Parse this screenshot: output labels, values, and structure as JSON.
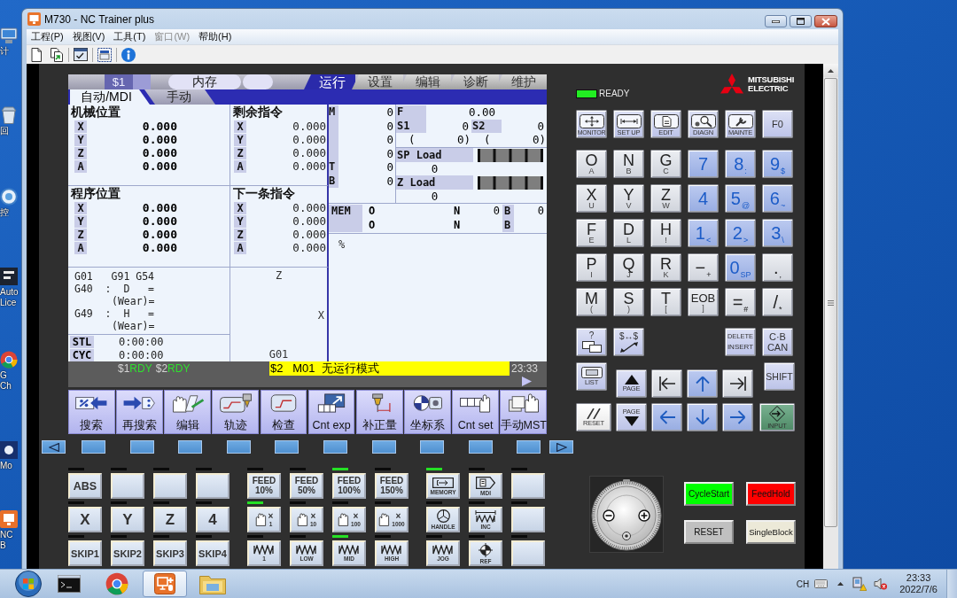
{
  "desktop": {
    "shortcuts": [
      {
        "label": "计"
      },
      {
        "label": "回"
      },
      {
        "label": "控"
      },
      {
        "label": "Auto Lice"
      },
      {
        "label": "G Ch"
      },
      {
        "label": "Mo"
      },
      {
        "label": "NC B"
      }
    ]
  },
  "window": {
    "title": "M730 - NC Trainer plus"
  },
  "menu": [
    {
      "label": "工程(P)",
      "disabled": false
    },
    {
      "label": "视图(V)",
      "disabled": false
    },
    {
      "label": "工具(T)",
      "disabled": false
    },
    {
      "label": "窗口(W)",
      "disabled": true
    },
    {
      "label": "帮助(H)",
      "disabled": false
    }
  ],
  "cnc_screen": {
    "system": "$1",
    "memory_mode": "内存",
    "tabs": [
      {
        "label": "运行",
        "selected": true
      },
      {
        "label": "设置",
        "selected": false
      },
      {
        "label": "编辑",
        "selected": false
      },
      {
        "label": "诊断",
        "selected": false
      },
      {
        "label": "维护",
        "selected": false
      }
    ],
    "subtabs": [
      {
        "label": "自动/MDI",
        "selected": true
      },
      {
        "label": "手动",
        "selected": false
      }
    ],
    "counters": [
      {
        "title": "机械位置",
        "kind": "main",
        "axes": [
          {
            "axis": "X",
            "value": "0.000"
          },
          {
            "axis": "Y",
            "value": "0.000"
          },
          {
            "axis": "Z",
            "value": "0.000"
          },
          {
            "axis": "A",
            "value": "0.000"
          }
        ]
      },
      {
        "title": "剩余指令",
        "kind": "sub",
        "axes": [
          {
            "axis": "X",
            "value": "0.000"
          },
          {
            "axis": "Y",
            "value": "0.000"
          },
          {
            "axis": "Z",
            "value": "0.000"
          },
          {
            "axis": "A",
            "value": "0.000"
          }
        ]
      },
      {
        "title": "程序位置",
        "kind": "main",
        "axes": [
          {
            "axis": "X",
            "value": "0.000"
          },
          {
            "axis": "Y",
            "value": "0.000"
          },
          {
            "axis": "Z",
            "value": "0.000"
          },
          {
            "axis": "A",
            "value": "0.000"
          }
        ]
      },
      {
        "title": "下一条指令",
        "kind": "sub",
        "axes": [
          {
            "axis": "X",
            "value": "0.000"
          },
          {
            "axis": "Y",
            "value": "0.000"
          },
          {
            "axis": "Z",
            "value": "0.000"
          },
          {
            "axis": "A",
            "value": "0.000"
          }
        ]
      }
    ],
    "modal": [
      {
        "kind": "line",
        "text": "G01   G91 G54"
      },
      {
        "kind": "line",
        "text": "G40  :  D   ="
      },
      {
        "kind": "wear",
        "text": "(Wear)="
      },
      {
        "kind": "line",
        "text": "G49  :  H   ="
      },
      {
        "kind": "wear",
        "text": "(Wear)="
      }
    ],
    "times": [
      {
        "label": "STL",
        "value": "0:00:00"
      },
      {
        "label": "CYC",
        "value": "0:00:00"
      }
    ],
    "plot": {
      "vertical_axis": "Z",
      "horizontal_axis": "X",
      "mode": "G01"
    },
    "codes": [
      {
        "label": "M",
        "value": "0"
      },
      {
        "value": "0"
      },
      {
        "value": "0"
      },
      {
        "value": "0"
      },
      {
        "label": "T",
        "value": "0"
      },
      {
        "label": "B",
        "value": "0"
      }
    ],
    "feed": {
      "label": "F",
      "value": "0.00"
    },
    "spindles": [
      {
        "label": "S1",
        "value": "0",
        "bracket": "(",
        "sub_value": "0)"
      },
      {
        "label": "S2",
        "value": "0",
        "bracket": "(",
        "sub_value": "0)"
      }
    ],
    "loads": [
      {
        "label": "SP Load",
        "value": "0"
      },
      {
        "label": "Z Load",
        "value": "0"
      }
    ],
    "program_rows": [
      {
        "mode": "MEM",
        "fields": [
          {
            "label": "O"
          },
          {
            "label": "N",
            "value": "0"
          },
          {
            "label": "B",
            "value": "0"
          }
        ]
      },
      {
        "fields": [
          {
            "label": "O"
          },
          {
            "label": "N"
          },
          {
            "label": "B"
          }
        ]
      }
    ],
    "program_text": "%",
    "channels": [
      {
        "system": "$1",
        "state": "RDY"
      },
      {
        "system": "$2",
        "state": "RDY"
      }
    ],
    "message": "$2   M01  无运行模式",
    "time": "23:33",
    "menu_keys": [
      {
        "label": "搜索"
      },
      {
        "label": "再搜索"
      },
      {
        "label": "编辑"
      },
      {
        "label": "轨迹"
      },
      {
        "label": "检查"
      },
      {
        "label": "Cnt exp"
      },
      {
        "label": "补正量"
      },
      {
        "label": "坐标系"
      },
      {
        "label": "Cnt set"
      },
      {
        "label": "手动MST"
      }
    ]
  },
  "softkeys": [
    {
      "kind": "prev"
    },
    {
      "kind": "blank"
    },
    {
      "kind": "blank"
    },
    {
      "kind": "blank"
    },
    {
      "kind": "blank"
    },
    {
      "kind": "blank"
    },
    {
      "kind": "blank"
    },
    {
      "kind": "blank"
    },
    {
      "kind": "blank"
    },
    {
      "kind": "blank"
    },
    {
      "kind": "blank"
    },
    {
      "kind": "next"
    }
  ],
  "keypad": {
    "ready": {
      "label": "READY",
      "on": true
    },
    "brand": [
      "MITSUBISHI",
      "ELECTRIC"
    ],
    "rows": [
      [
        {
          "kind": "func",
          "caption": "MONITOR"
        },
        {
          "kind": "func",
          "caption": "SET UP"
        },
        {
          "kind": "func",
          "caption": "EDIT"
        },
        {
          "kind": "func",
          "caption": "DIAGN"
        },
        {
          "kind": "func",
          "caption": "MAINTE"
        },
        {
          "kind": "text",
          "main": "F0"
        }
      ],
      [
        {
          "kind": "alpha",
          "main": "O",
          "sub": "A"
        },
        {
          "kind": "alpha",
          "main": "N",
          "sub": "B"
        },
        {
          "kind": "alpha",
          "main": "G",
          "sub": "C"
        },
        {
          "kind": "digit",
          "main": "7"
        },
        {
          "kind": "digit",
          "main": "8",
          "sub": ":"
        },
        {
          "kind": "digit",
          "main": "9",
          "sub": "$"
        }
      ],
      [
        {
          "kind": "alpha",
          "main": "X",
          "sub": "U"
        },
        {
          "kind": "alpha",
          "main": "Y",
          "sub": "V"
        },
        {
          "kind": "alpha",
          "main": "Z",
          "sub": "W"
        },
        {
          "kind": "digit",
          "main": "4"
        },
        {
          "kind": "digit",
          "main": "5",
          "sub": "@"
        },
        {
          "kind": "digit",
          "main": "6",
          "sub": "~"
        }
      ],
      [
        {
          "kind": "alpha",
          "main": "F",
          "sub": "E"
        },
        {
          "kind": "alpha",
          "main": "D",
          "sub": "L"
        },
        {
          "kind": "alpha",
          "main": "H",
          "sub": "!"
        },
        {
          "kind": "digit",
          "main": "1",
          "sub": "<"
        },
        {
          "kind": "digit",
          "main": "2",
          "sub": ">"
        },
        {
          "kind": "digit",
          "main": "3",
          "sub": "\\"
        }
      ],
      [
        {
          "kind": "alpha",
          "main": "P",
          "sub": "I"
        },
        {
          "kind": "alpha",
          "main": "Q",
          "sub": "J"
        },
        {
          "kind": "alpha",
          "main": "R",
          "sub": "K"
        },
        {
          "kind": "symbol",
          "main": "−",
          "sub": "+"
        },
        {
          "kind": "digit",
          "main": "0",
          "sub": "SP"
        },
        {
          "kind": "symbol",
          "main": ".",
          "sub": ","
        }
      ],
      [
        {
          "kind": "alpha",
          "main": "M",
          "sub": "("
        },
        {
          "kind": "alpha",
          "main": "S",
          "sub": ")"
        },
        {
          "kind": "alpha",
          "main": "T",
          "sub": "["
        },
        {
          "kind": "eob",
          "main": "EOB",
          "sub": "]"
        },
        {
          "kind": "symbol",
          "main": "=",
          "sub": "#"
        },
        {
          "kind": "symbol",
          "main": "/",
          "sub": "*"
        }
      ],
      [
        {
          "kind": "help",
          "main": "?"
        },
        {
          "kind": "system",
          "main": "$↔$"
        },
        "",
        "",
        {
          "kind": "text",
          "main": "DELETE",
          "sub": "INSERT"
        },
        {
          "kind": "text",
          "main": "C·B",
          "sub": "CAN"
        }
      ],
      [
        {
          "kind": "list",
          "caption": "LIST"
        },
        {
          "kind": "page_up",
          "caption": "PAGE"
        },
        {
          "kind": "home"
        },
        {
          "kind": "up"
        },
        {
          "kind": "end"
        },
        {
          "kind": "text",
          "main": "SHIFT"
        }
      ],
      [
        {
          "kind": "reset",
          "caption": "RESET"
        },
        {
          "kind": "page_down",
          "caption": "PAGE"
        },
        {
          "kind": "left"
        },
        {
          "kind": "down"
        },
        {
          "kind": "right"
        },
        {
          "kind": "input",
          "caption": "INPUT"
        }
      ]
    ]
  },
  "operation_panel": {
    "groups": [
      {
        "rows": [
          [
            {
              "kind": "text",
              "label": "ABS",
              "lit": false
            },
            {
              "kind": "blank",
              "lit": false
            },
            {
              "kind": "blank",
              "lit": false
            },
            {
              "kind": "blank",
              "lit": false
            }
          ],
          [
            {
              "kind": "axis",
              "label": "X",
              "lit": false
            },
            {
              "kind": "axis",
              "label": "Y",
              "lit": false
            },
            {
              "kind": "axis",
              "label": "Z",
              "lit": false
            },
            {
              "kind": "axis",
              "label": "4",
              "lit": false
            }
          ],
          [
            {
              "kind": "text",
              "label": "SKIP1",
              "lit": false
            },
            {
              "kind": "text",
              "label": "SKIP2",
              "lit": false
            },
            {
              "kind": "text",
              "label": "SKIP3",
              "lit": false
            },
            {
              "kind": "text",
              "label": "SKIP4",
              "lit": false
            }
          ]
        ]
      },
      {
        "rows": [
          [
            {
              "kind": "feed",
              "label": "FEED",
              "caption": "10%",
              "lit": false
            },
            {
              "kind": "feed",
              "label": "FEED",
              "caption": "50%",
              "lit": false
            },
            {
              "kind": "feed",
              "label": "FEED",
              "caption": "100%",
              "lit": true
            },
            {
              "kind": "feed",
              "label": "FEED",
              "caption": "150%",
              "lit": false
            }
          ],
          [
            {
              "kind": "hand",
              "label": "×",
              "caption": "1",
              "lit": true
            },
            {
              "kind": "hand",
              "label": "×",
              "caption": "10",
              "lit": false
            },
            {
              "kind": "hand",
              "label": "×",
              "caption": "100",
              "lit": false
            },
            {
              "kind": "hand",
              "label": "×",
              "caption": "1000",
              "lit": false
            }
          ],
          [
            {
              "kind": "wave",
              "caption": "1",
              "lit": false
            },
            {
              "kind": "wave",
              "caption": "LOW",
              "lit": false
            },
            {
              "kind": "wave",
              "caption": "MID",
              "lit": true
            },
            {
              "kind": "wave",
              "caption": "HIGH",
              "lit": false
            }
          ]
        ]
      },
      {
        "rows": [
          [
            {
              "kind": "memory",
              "caption": "MEMORY",
              "lit": true
            },
            {
              "kind": "mdi",
              "caption": "MDI",
              "lit": false
            },
            {
              "kind": "blank",
              "lit": false
            }
          ],
          [
            {
              "kind": "handle",
              "caption": "HANDLE",
              "lit": false
            },
            {
              "kind": "inc",
              "caption": "INC",
              "lit": false
            },
            {
              "kind": "blank",
              "lit": false
            }
          ],
          [
            {
              "kind": "wave",
              "caption": "JOG",
              "lit": false
            },
            {
              "kind": "ref",
              "caption": "REF",
              "lit": false
            },
            {
              "kind": "blank",
              "lit": false
            }
          ]
        ]
      }
    ]
  },
  "operation_buttons": [
    {
      "label": "CycleStart",
      "color": "#00ff00"
    },
    {
      "label": "FeedHold",
      "color": "#ff0000"
    },
    {
      "label": "RESET",
      "color": "#c0c0c0"
    },
    {
      "label": "SingleBlock",
      "color": "#ece9d8"
    }
  ],
  "taskbar": {
    "apps": [
      {
        "selected": false
      },
      {
        "selected": false
      },
      {
        "selected": true
      },
      {
        "selected": false
      }
    ],
    "language": "CH",
    "time": "23:33",
    "date": "2022/7/6"
  }
}
